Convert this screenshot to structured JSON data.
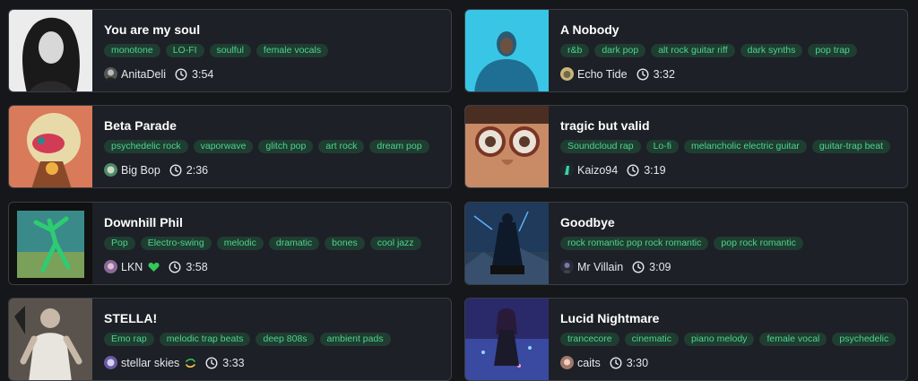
{
  "tracks": [
    {
      "title": "You are my soul",
      "tags": [
        "monotone",
        "LO-FI",
        "soulful",
        "female vocals"
      ],
      "artist": "AnitaDeli",
      "duration": "3:54"
    },
    {
      "title": "A Nobody",
      "tags": [
        "r&b",
        "dark pop",
        "alt rock guitar riff",
        "dark synths",
        "pop trap"
      ],
      "artist": "Echo Tide",
      "duration": "3:32"
    },
    {
      "title": "Beta Parade",
      "tags": [
        "psychedelic rock",
        "vaporwave",
        "glitch pop",
        "art rock",
        "dream pop"
      ],
      "artist": "Big Bop",
      "duration": "2:36"
    },
    {
      "title": "tragic but valid",
      "tags": [
        "Soundcloud rap",
        "Lo-fi",
        "melancholic electric guitar",
        "guitar-trap beat"
      ],
      "artist": "Kaizo94",
      "duration": "3:19"
    },
    {
      "title": "Downhill Phil",
      "tags": [
        "Pop",
        "Electro-swing",
        "melodic",
        "dramatic",
        "bones",
        "cool jazz"
      ],
      "artist": "LKN",
      "duration": "3:58",
      "badge": "heart-icon"
    },
    {
      "title": "Goodbye",
      "tags": [
        "rock romantic pop rock romantic",
        "pop rock romantic"
      ],
      "artist": "Mr Villain",
      "duration": "3:09"
    },
    {
      "title": "STELLA!",
      "tags": [
        "Emo rap",
        "melodic trap beats",
        "deep 808s",
        "ambient pads"
      ],
      "artist": "stellar skies",
      "duration": "3:33",
      "badge": "swirl-badge-icon"
    },
    {
      "title": "Lucid Nightmare",
      "tags": [
        "trancecore",
        "cinematic",
        "piano melody",
        "female vocal",
        "psychedelic"
      ],
      "artist": "caits",
      "duration": "3:30"
    }
  ],
  "colors": {
    "background": "#15171b",
    "card": "#1d2026",
    "card_border": "#3a3e46",
    "tag_bg": "#1f3d31",
    "tag_text": "#4fd38e",
    "heart": "#35c759"
  },
  "icons": {
    "duration": "clock-icon"
  }
}
